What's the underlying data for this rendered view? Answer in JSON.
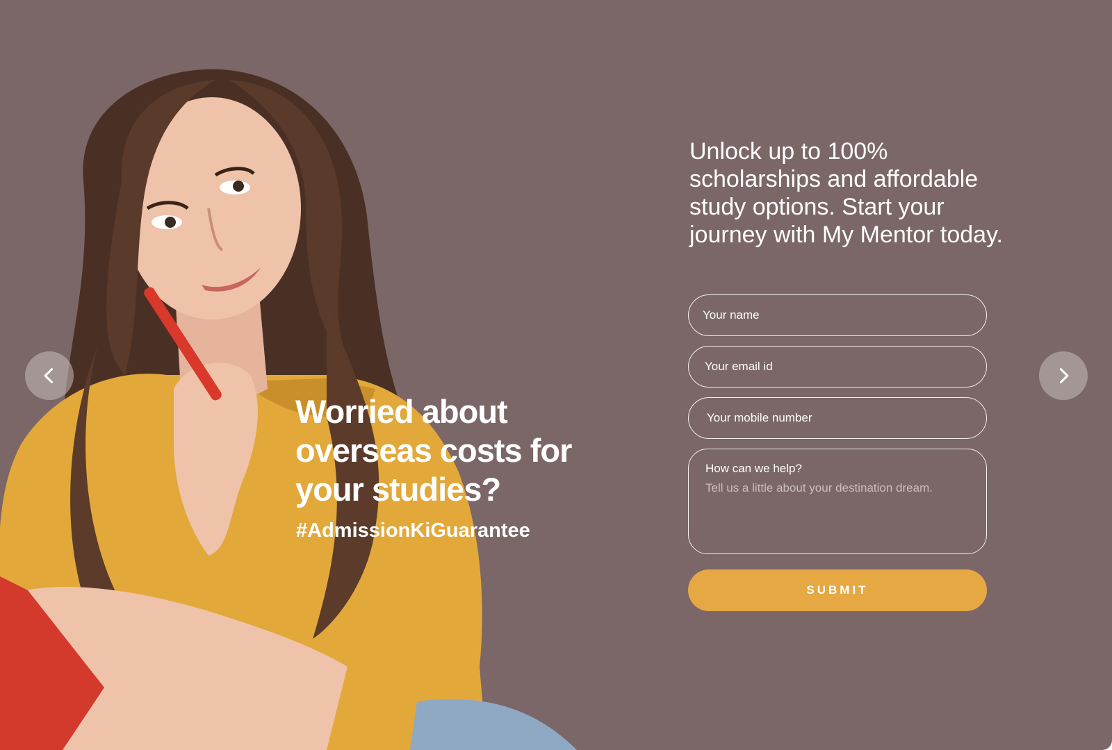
{
  "slide": {
    "background": "#7b6767",
    "accent": "#e6a843"
  },
  "headline": {
    "line1": "Worried about",
    "line2": "overseas costs for",
    "line3": "your studies?",
    "hashtag": "#AdmissionKiGuarantee"
  },
  "promo": {
    "line1": "Unlock up to 100%",
    "line2": "scholarships and affordable",
    "line3": "study options. Start your",
    "line4": "journey with My Mentor today."
  },
  "form": {
    "name_placeholder": "Your name",
    "email_placeholder": "Your email id",
    "mobile_placeholder": "Your mobile number",
    "help_label": "How can we help?",
    "help_placeholder": "Tell us a little about your destination dream.",
    "submit_label": "SUBMIT"
  },
  "carousel": {
    "prev_icon": "chevron-left-icon",
    "next_icon": "chevron-right-icon"
  }
}
